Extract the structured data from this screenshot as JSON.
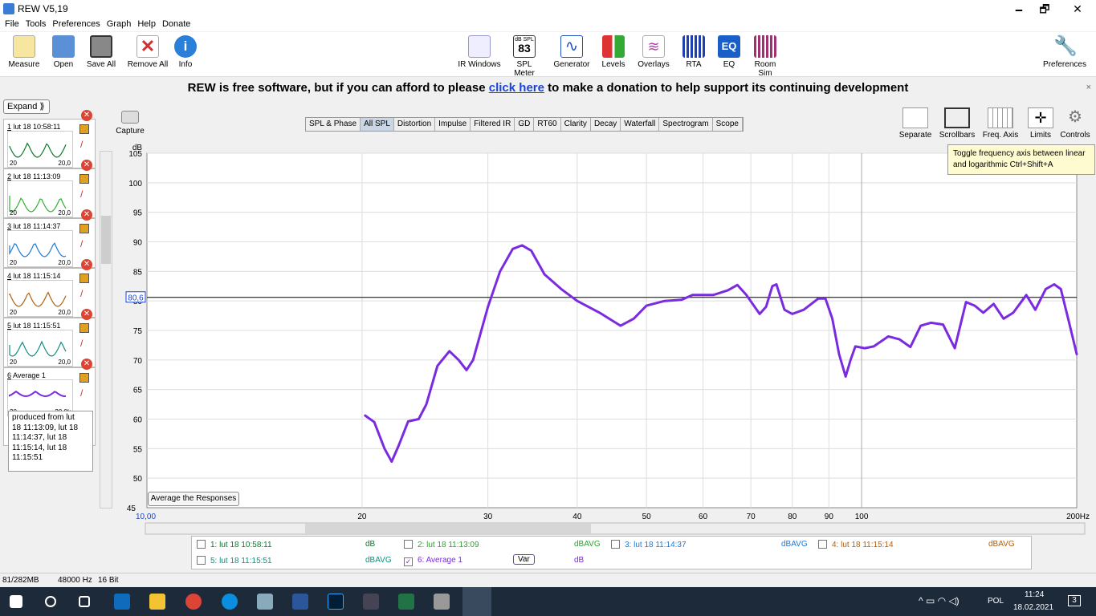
{
  "window": {
    "title": "REW V5,19",
    "controls": [
      "🗕",
      "🗗",
      "✕"
    ]
  },
  "menu": [
    "File",
    "Tools",
    "Preferences",
    "Graph",
    "Help",
    "Donate"
  ],
  "toolbar": {
    "left": [
      {
        "label": "Measure",
        "icon": "measure-icon",
        "color": "#e8b030"
      },
      {
        "label": "Open",
        "icon": "folder-icon",
        "color": "#5b8fd6"
      },
      {
        "label": "Save All",
        "icon": "save-icon",
        "color": "#555"
      },
      {
        "label": "Remove All",
        "icon": "remove-icon",
        "color": "#c33"
      },
      {
        "label": "Info",
        "icon": "info-icon",
        "color": "#2a7fd8"
      }
    ],
    "center": [
      {
        "label": "IR Windows",
        "icon": "ir-windows-icon",
        "color": "#6a8fd0"
      },
      {
        "label": "SPL Meter",
        "icon": "spl-meter-icon",
        "color": "#333",
        "text": "83",
        "subtext": "dB SPL"
      },
      {
        "label": "Generator",
        "icon": "generator-icon",
        "color": "#2050c0"
      },
      {
        "label": "Levels",
        "icon": "levels-icon",
        "color": "#d33"
      },
      {
        "label": "Overlays",
        "icon": "overlays-icon",
        "color": "#5aa"
      },
      {
        "label": "RTA",
        "icon": "rta-icon",
        "color": "#2040b0"
      },
      {
        "label": "EQ",
        "icon": "eq-icon",
        "color": "#1a5fc8",
        "text": "EQ"
      },
      {
        "label": "Room Sim",
        "icon": "room-sim-icon",
        "color": "#a03070"
      }
    ],
    "right": [
      {
        "label": "Preferences",
        "icon": "wrench-icon",
        "color": "#777"
      }
    ]
  },
  "donate": {
    "before": "REW is free software, but if you can afford to please ",
    "link": "click here",
    "after": " to make a donation to help support its continuing development",
    "close": "×"
  },
  "sidebar": {
    "expand": "Expand",
    "measurements": [
      {
        "num": "1",
        "name": "lut 18 10:58:11",
        "color": "#0a7a2a",
        "axis_left": "20",
        "axis_right": "20,0"
      },
      {
        "num": "2",
        "name": "lut 18 11:13:09",
        "color": "#30b030",
        "axis_left": "20",
        "axis_right": "20,0"
      },
      {
        "num": "3",
        "name": "lut 18 11:14:37",
        "color": "#1e78d8",
        "axis_left": "20",
        "axis_right": "20,0"
      },
      {
        "num": "4",
        "name": "lut 18 11:15:14",
        "color": "#b06010",
        "axis_left": "20",
        "axis_right": "20,0"
      },
      {
        "num": "5",
        "name": "lut 18 11:15:51",
        "color": "#109080",
        "axis_left": "20",
        "axis_right": "20,0"
      },
      {
        "num": "6",
        "name": "Average 1",
        "color": "#7a2be0",
        "axis_left": "20",
        "axis_right": "20,0k"
      }
    ],
    "notes": [
      "produced from lut",
      "18 11:13:09, lut 18",
      "11:14:37, lut 18",
      "11:15:14, lut 18",
      "11:15:51"
    ]
  },
  "capture": "Capture",
  "tabs": [
    "SPL & Phase",
    "All SPL",
    "Distortion",
    "Impulse",
    "Filtered IR",
    "GD",
    "RT60",
    "Clarity",
    "Decay",
    "Waterfall",
    "Spectrogram",
    "Scope"
  ],
  "selected_tab": "All SPL",
  "right_tools": [
    {
      "label": "Separate",
      "icon": "separate-icon"
    },
    {
      "label": "Scrollbars",
      "icon": "scrollbars-icon"
    },
    {
      "label": "Freq. Axis",
      "icon": "freq-axis-icon"
    },
    {
      "label": "Limits",
      "icon": "limits-icon"
    },
    {
      "label": "Controls",
      "icon": "gear-icon"
    }
  ],
  "tooltip": "Toggle frequency axis between linear and logarithmic Ctrl+Shift+A",
  "average_button": "Average the Responses",
  "chart_data": {
    "type": "line",
    "ylabel": "dB",
    "ylim": [
      45,
      105
    ],
    "xlim": [
      10,
      200
    ],
    "x_log": true,
    "x_ticks": [
      20,
      30,
      40,
      50,
      60,
      70,
      80,
      90,
      100
    ],
    "x_tick_labels": [
      "20",
      "30",
      "40",
      "50",
      "60",
      "70",
      "80",
      "90",
      "100"
    ],
    "x_left_label": "10,00",
    "x_right_label": "200Hz",
    "y_ticks": [
      50,
      55,
      60,
      65,
      70,
      75,
      80,
      85,
      90,
      95,
      100,
      105
    ],
    "cursor_level": 80.6,
    "cursor_label": "80,6",
    "grid": true,
    "series": [
      {
        "name": "6: Average 1",
        "color": "#7a2be0",
        "points": [
          [
            20.2,
            60.6
          ],
          [
            20.8,
            59.5
          ],
          [
            21.5,
            55
          ],
          [
            22,
            52.8
          ],
          [
            22.5,
            55.5
          ],
          [
            23.2,
            59.6
          ],
          [
            24,
            60
          ],
          [
            24.6,
            62.5
          ],
          [
            25.5,
            69
          ],
          [
            26.5,
            71.5
          ],
          [
            27.3,
            70
          ],
          [
            28,
            68.3
          ],
          [
            28.6,
            70
          ],
          [
            30,
            79
          ],
          [
            31.2,
            85
          ],
          [
            32.5,
            88.8
          ],
          [
            33.5,
            89.4
          ],
          [
            34.5,
            88.5
          ],
          [
            36,
            84.5
          ],
          [
            38,
            82
          ],
          [
            40,
            80
          ],
          [
            43,
            78
          ],
          [
            46,
            75.8
          ],
          [
            48,
            77
          ],
          [
            50,
            79.2
          ],
          [
            53,
            80
          ],
          [
            56,
            80.2
          ],
          [
            58,
            81
          ],
          [
            62,
            81
          ],
          [
            65,
            81.8
          ],
          [
            67,
            82.7
          ],
          [
            69,
            81
          ],
          [
            72,
            77.8
          ],
          [
            73.5,
            79
          ],
          [
            75,
            82.5
          ],
          [
            76,
            82.8
          ],
          [
            78,
            78.5
          ],
          [
            80,
            77.8
          ],
          [
            83,
            78.5
          ],
          [
            87,
            80.4
          ],
          [
            89,
            80.4
          ],
          [
            91,
            77
          ],
          [
            93,
            71
          ],
          [
            95,
            67.2
          ],
          [
            96.5,
            70
          ],
          [
            98,
            72.3
          ],
          [
            101,
            72
          ],
          [
            104,
            72.3
          ],
          [
            109,
            74
          ],
          [
            113,
            73.5
          ],
          [
            117,
            72.2
          ],
          [
            121,
            75.8
          ],
          [
            125,
            76.3
          ],
          [
            130,
            76
          ],
          [
            135,
            72
          ],
          [
            140,
            79.8
          ],
          [
            144,
            79.2
          ],
          [
            148,
            78
          ],
          [
            153,
            79.5
          ],
          [
            158,
            77
          ],
          [
            163,
            78
          ],
          [
            170,
            81
          ],
          [
            175,
            78.5
          ],
          [
            181,
            82
          ],
          [
            186,
            82.8
          ],
          [
            190,
            82
          ],
          [
            195,
            76.5
          ],
          [
            200,
            71
          ]
        ]
      }
    ]
  },
  "legend": [
    {
      "text": "1: lut 18 10:58:11",
      "unit": "dB",
      "color": "#0a7a2a",
      "checked": false
    },
    {
      "text": "2: lut 18 11:13:09",
      "unit": "dBAVG",
      "color": "#30a030",
      "checked": false
    },
    {
      "text": "3: lut 18 11:14:37",
      "unit": "dBAVG",
      "color": "#1e78d8",
      "checked": false
    },
    {
      "text": "4: lut 18 11:15:14",
      "unit": "dBAVG",
      "color": "#b06010",
      "checked": false
    },
    {
      "text": "5: lut 18 11:15:51",
      "unit": "dBAVG",
      "color": "#109080",
      "checked": false
    },
    {
      "text": "6: Average 1",
      "unit": "dB",
      "color": "#7a2be0",
      "checked": true,
      "extra": "Var"
    }
  ],
  "status": [
    "81/282MB",
    "48000 Hz",
    "16 Bit"
  ],
  "taskbar": {
    "time": "11:24",
    "date": "18.02.2021",
    "lang": "POL",
    "notif": "3"
  }
}
